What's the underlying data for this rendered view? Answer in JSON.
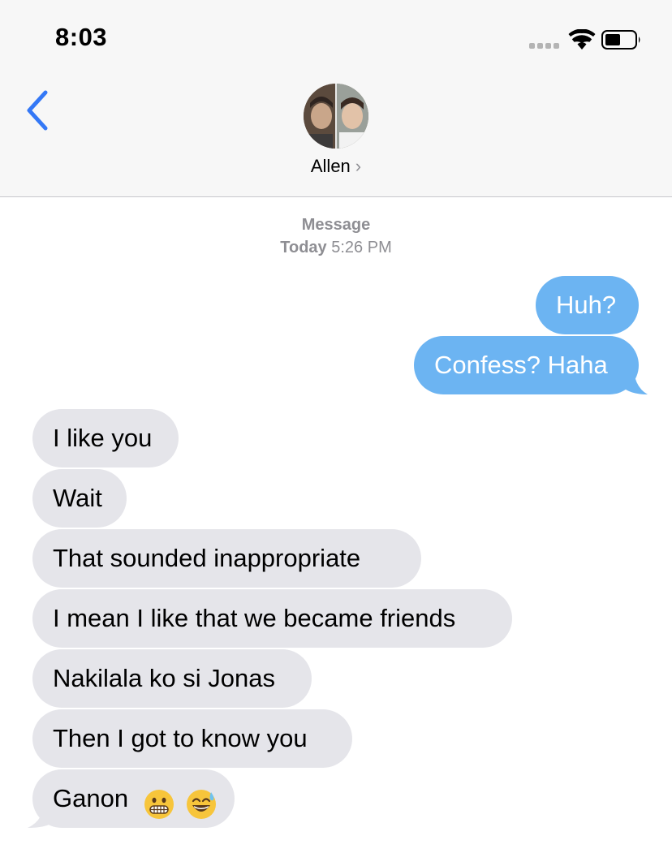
{
  "status_bar": {
    "time": "8:03"
  },
  "header": {
    "contact_name": "Allen",
    "chevron": "›"
  },
  "thread_meta": {
    "service": "Message",
    "day": "Today",
    "time": "5:26 PM"
  },
  "messages": [
    {
      "direction": "sent",
      "text": "Huh?"
    },
    {
      "direction": "sent",
      "text": "Confess? Haha"
    },
    {
      "direction": "received",
      "text": "I like you"
    },
    {
      "direction": "received",
      "text": "Wait"
    },
    {
      "direction": "received",
      "text": "That sounded inappropriate"
    },
    {
      "direction": "received",
      "text": "I mean I like that we became friends"
    },
    {
      "direction": "received",
      "text": "Nakilala ko si Jonas"
    },
    {
      "direction": "received",
      "text": "Then I got to know you"
    },
    {
      "direction": "received",
      "text": "Ganon"
    }
  ],
  "icons": {
    "back": "chevron-left-icon",
    "signal": "cellular-signal-icon",
    "wifi": "wifi-icon",
    "battery": "battery-icon",
    "emoji_1": "grimacing-face-emoji",
    "emoji_2": "grinning-face-with-sweat-emoji"
  },
  "colors": {
    "sent_bubble": "#6cb4f2",
    "received_bubble": "#e5e5ea",
    "accent": "#3478f6",
    "meta_text": "#8e8e93"
  }
}
